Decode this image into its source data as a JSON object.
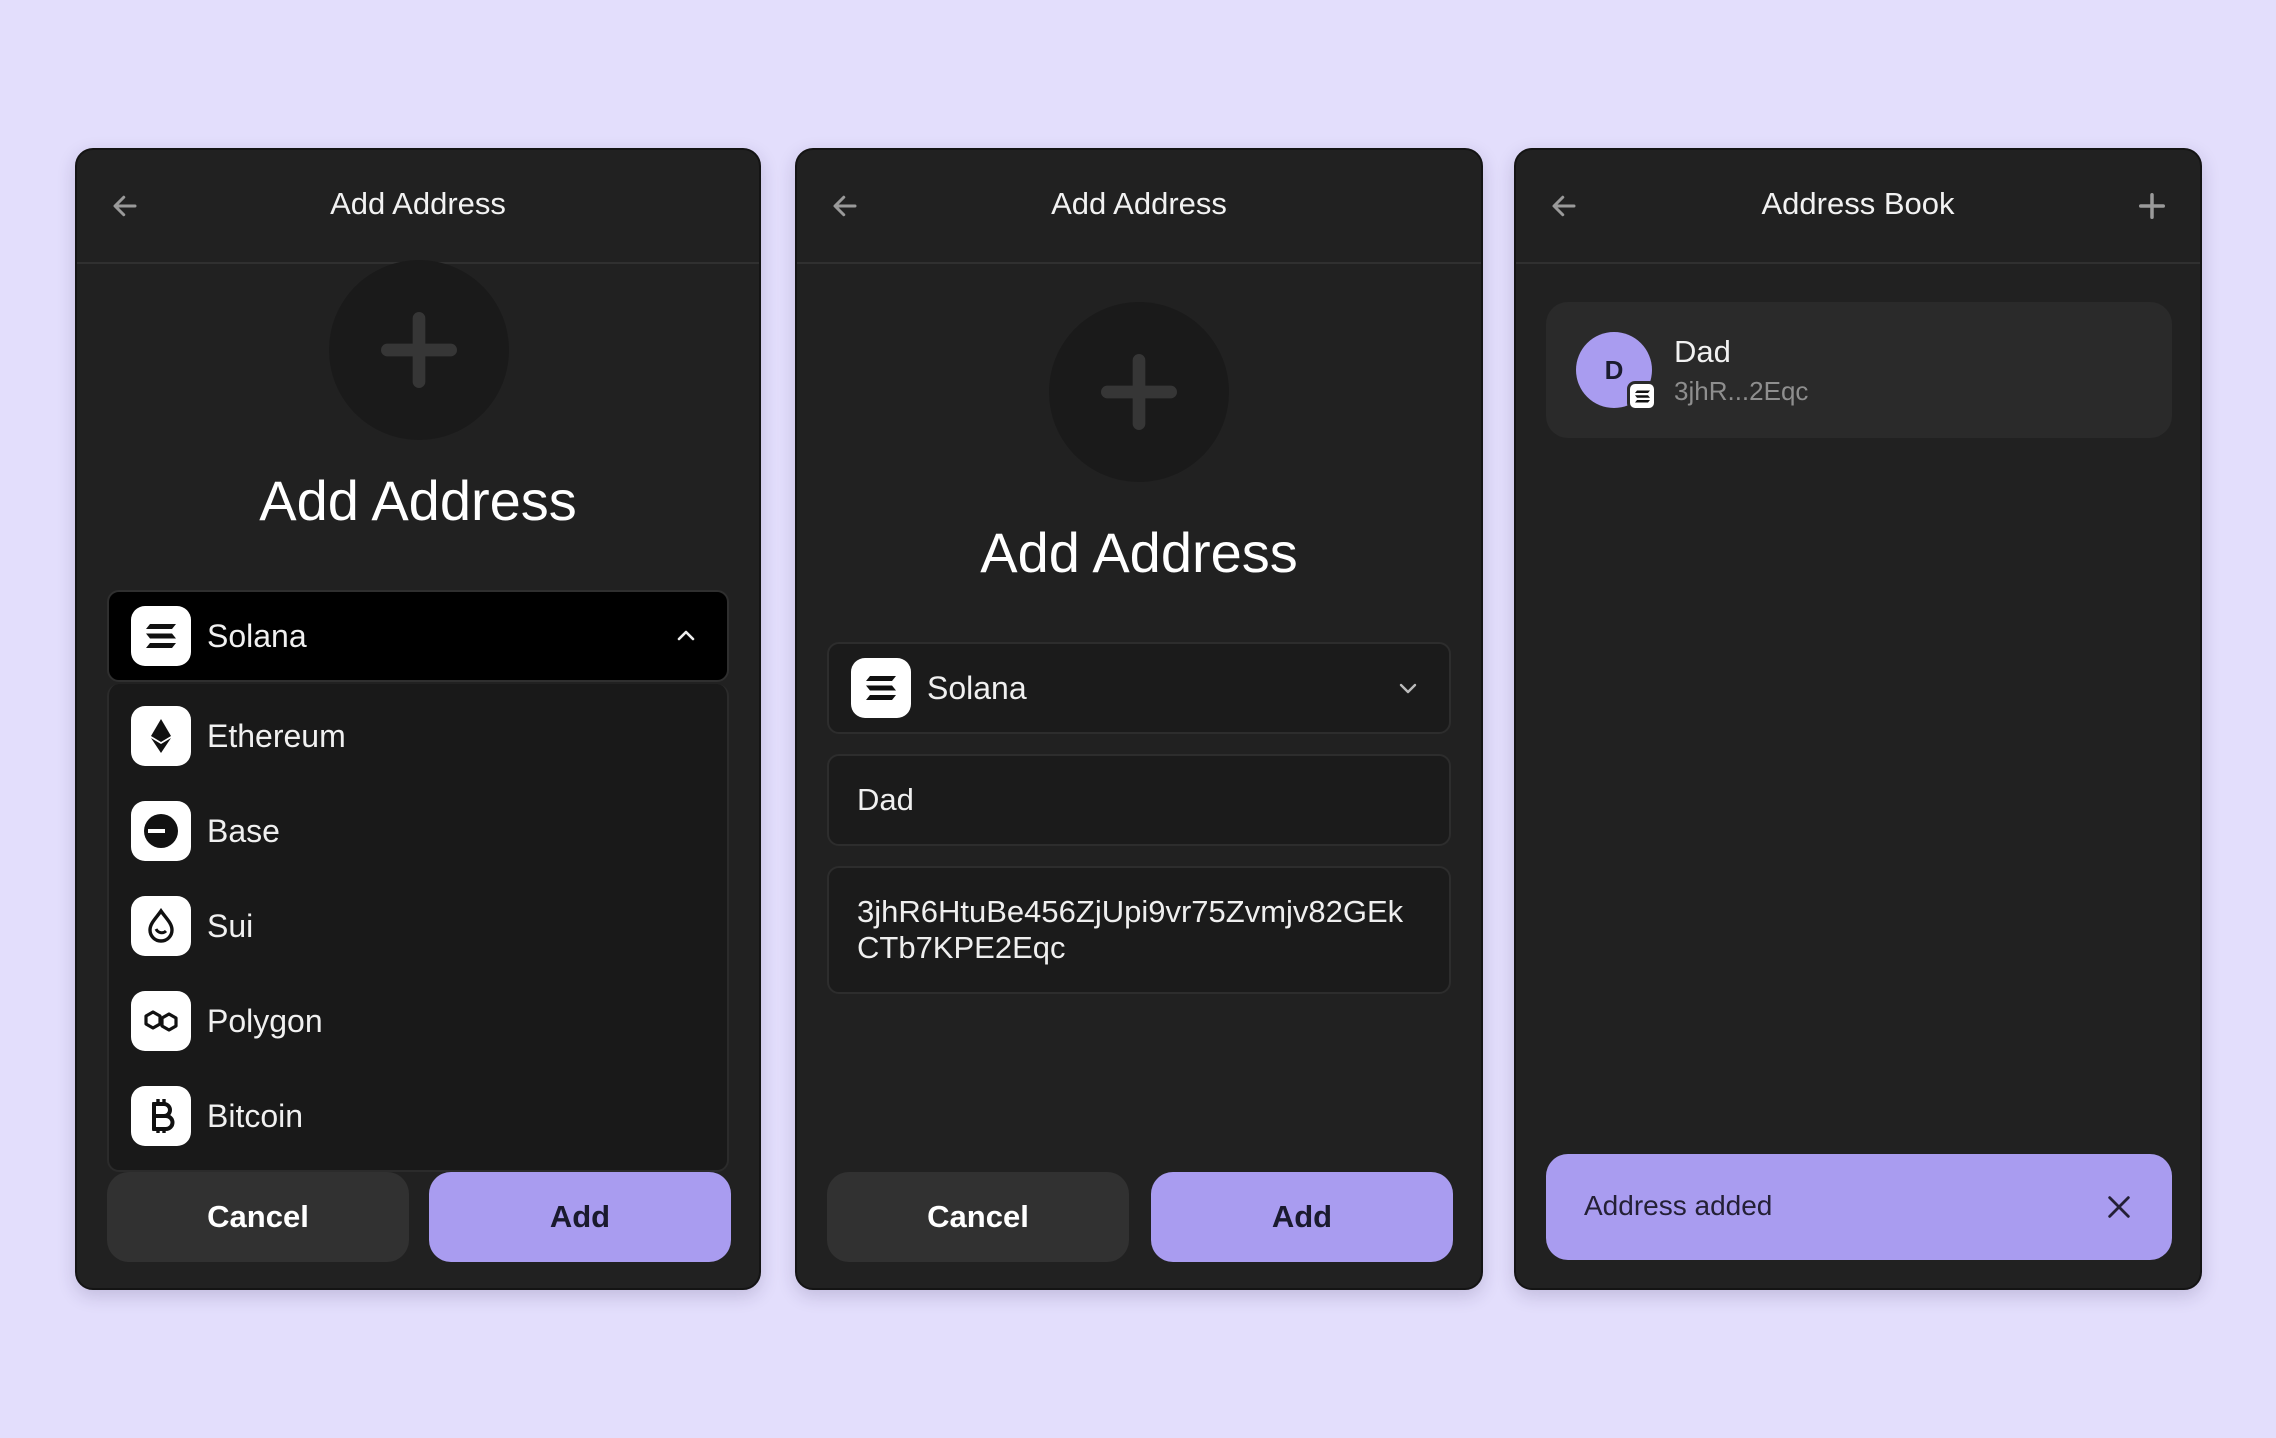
{
  "colors": {
    "background": "#e3defc",
    "panel": "#212121",
    "accent": "#a99cf0",
    "muted_text": "#8e8e8e"
  },
  "panel1": {
    "header_title": "Add Address",
    "title": "Add Address",
    "selected_chain": "Solana",
    "selected_chain_icon": "solana-icon",
    "dropdown_items": [
      {
        "label": "Ethereum",
        "icon": "ethereum-icon"
      },
      {
        "label": "Base",
        "icon": "base-icon"
      },
      {
        "label": "Sui",
        "icon": "sui-icon"
      },
      {
        "label": "Polygon",
        "icon": "polygon-icon"
      },
      {
        "label": "Bitcoin",
        "icon": "bitcoin-icon"
      }
    ],
    "cancel_label": "Cancel",
    "add_label": "Add"
  },
  "panel2": {
    "header_title": "Add Address",
    "title": "Add Address",
    "selected_chain": "Solana",
    "name_value": "Dad",
    "address_value": "3jhR6HtuBe456ZjUpi9vr75Zvmjv82GEkCTb7KPE2Eqc",
    "cancel_label": "Cancel",
    "add_label": "Add"
  },
  "panel3": {
    "header_title": "Address Book",
    "contact": {
      "initial": "D",
      "name": "Dad",
      "address_short": "3jhR...2Eqc",
      "chain_icon": "solana-icon"
    },
    "toast_message": "Address added"
  }
}
